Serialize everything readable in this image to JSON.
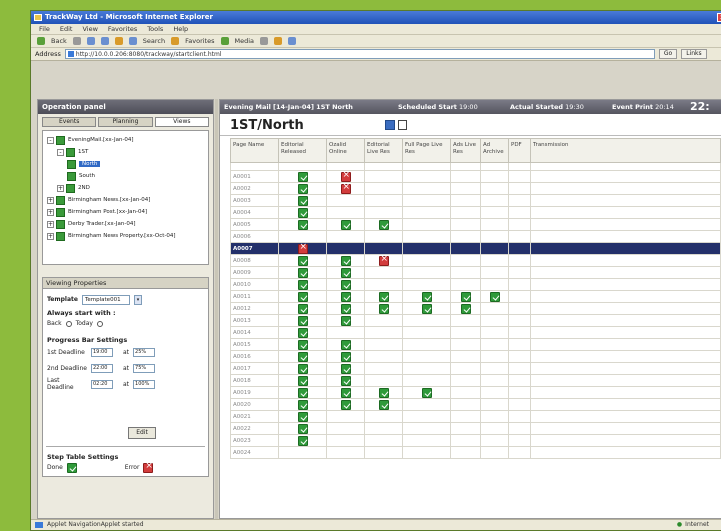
{
  "window": {
    "title": "TrackWay Ltd - Microsoft Internet Explorer"
  },
  "menu": [
    "File",
    "Edit",
    "View",
    "Favorites",
    "Tools",
    "Help"
  ],
  "toolbar": {
    "back": "Back",
    "search": "Search",
    "favorites": "Favorites",
    "media": "Media"
  },
  "address": {
    "label": "Address",
    "url": "http://10.0.0.206:8080/trackway/startclient.html",
    "go": "Go",
    "links": "Links"
  },
  "left": {
    "header": "Operation panel",
    "tabs": [
      "Events",
      "Planning",
      "Views"
    ],
    "tree": [
      {
        "label": "EveningMail.[xx-Jan-04]",
        "level": 0,
        "exp": "-"
      },
      {
        "label": "1ST",
        "level": 1,
        "exp": "-"
      },
      {
        "label": "North",
        "level": 2,
        "exp": "",
        "selected": true
      },
      {
        "label": "South",
        "level": 2,
        "exp": ""
      },
      {
        "label": "2ND",
        "level": 1,
        "exp": "+"
      },
      {
        "label": "Birmingham News.[xx-Jan-04]",
        "level": 0,
        "exp": "+"
      },
      {
        "label": "Birmingham Post.[xx-Jan-04]",
        "level": 0,
        "exp": "+"
      },
      {
        "label": "Derby Trader.[xx-Jan-04]",
        "level": 0,
        "exp": "+"
      },
      {
        "label": "Birmingham News Property.[xx-Oct-04]",
        "level": 0,
        "exp": "+"
      }
    ],
    "props_header": "Viewing Properties",
    "template_label": "Template",
    "template_value": "Template001",
    "always_start": "Always start with :",
    "radio_back": "Back",
    "radio_today": "Today",
    "prog_bar_title": "Progress Bar Settings",
    "deadlines": [
      {
        "label": "1st Deadline",
        "time": "19:00",
        "at": "at",
        "pct": "25%"
      },
      {
        "label": "2nd Deadline",
        "time": "22:00",
        "at": "at",
        "pct": "75%"
      },
      {
        "label": "Last Deadline",
        "time": "02:20",
        "at": "at",
        "pct": "100%"
      }
    ],
    "edit_button": "Edit",
    "step_title": "Step Table Settings",
    "done_label": "Done",
    "error_label": "Error"
  },
  "event": {
    "title": "Evening Mail [14-Jan-04] 1ST North",
    "sched_label": "Scheduled Start",
    "sched_value": "19:00",
    "actual_label": "Actual Started",
    "actual_value": "19:30",
    "event_label": "Event Print",
    "event_value": "20:14",
    "clock": "22:"
  },
  "section_title": "1ST/North",
  "grid": {
    "columns": [
      "Page Name",
      "Editorial Released",
      "Ozalid Online",
      "Editorial Live Res",
      "Full Page Live Res",
      "Ads Live Res",
      "Ad Archive",
      "PDF",
      "Transmission"
    ],
    "rows": [
      {
        "name": "",
        "cells": [
          "",
          "",
          "",
          "",
          "",
          "",
          "",
          ""
        ]
      },
      {
        "name": "A0001",
        "cells": [
          "g",
          "r",
          "",
          "",
          "",
          "",
          "",
          ""
        ]
      },
      {
        "name": "A0002",
        "cells": [
          "g",
          "r",
          "",
          "",
          "",
          "",
          "",
          ""
        ]
      },
      {
        "name": "A0003",
        "cells": [
          "g",
          "",
          "",
          "",
          "",
          "",
          "",
          ""
        ]
      },
      {
        "name": "A0004",
        "cells": [
          "g",
          "",
          "",
          "",
          "",
          "",
          "",
          ""
        ]
      },
      {
        "name": "A0005",
        "cells": [
          "g",
          "g",
          "g",
          "",
          "",
          "",
          "",
          ""
        ]
      },
      {
        "name": "A0006",
        "cells": [
          "",
          "",
          "",
          "",
          "",
          "",
          "",
          ""
        ]
      },
      {
        "name": "A0007",
        "cells": [
          "r",
          "",
          "",
          "",
          "",
          "",
          "",
          ""
        ],
        "selected": true
      },
      {
        "name": "A0008",
        "cells": [
          "g",
          "g",
          "r",
          "",
          "",
          "",
          "",
          ""
        ]
      },
      {
        "name": "A0009",
        "cells": [
          "g",
          "g",
          "",
          "",
          "",
          "",
          "",
          ""
        ]
      },
      {
        "name": "A0010",
        "cells": [
          "g",
          "g",
          "",
          "",
          "",
          "",
          "",
          ""
        ]
      },
      {
        "name": "A0011",
        "cells": [
          "g",
          "g",
          "g",
          "g",
          "g",
          "g",
          "",
          ""
        ]
      },
      {
        "name": "A0012",
        "cells": [
          "g",
          "g",
          "g",
          "g",
          "g",
          "",
          "",
          ""
        ]
      },
      {
        "name": "A0013",
        "cells": [
          "g",
          "g",
          "",
          "",
          "",
          "",
          "",
          ""
        ]
      },
      {
        "name": "A0014",
        "cells": [
          "g",
          "",
          "",
          "",
          "",
          "",
          "",
          ""
        ]
      },
      {
        "name": "A0015",
        "cells": [
          "g",
          "g",
          "",
          "",
          "",
          "",
          "",
          ""
        ]
      },
      {
        "name": "A0016",
        "cells": [
          "g",
          "g",
          "",
          "",
          "",
          "",
          "",
          ""
        ]
      },
      {
        "name": "A0017",
        "cells": [
          "g",
          "g",
          "",
          "",
          "",
          "",
          "",
          ""
        ]
      },
      {
        "name": "A0018",
        "cells": [
          "g",
          "g",
          "",
          "",
          "",
          "",
          "",
          ""
        ]
      },
      {
        "name": "A0019",
        "cells": [
          "g",
          "g",
          "g",
          "g",
          "",
          "",
          "",
          ""
        ]
      },
      {
        "name": "A0020",
        "cells": [
          "g",
          "g",
          "g",
          "",
          "",
          "",
          "",
          ""
        ]
      },
      {
        "name": "A0021",
        "cells": [
          "g",
          "",
          "",
          "",
          "",
          "",
          "",
          ""
        ]
      },
      {
        "name": "A0022",
        "cells": [
          "g",
          "",
          "",
          "",
          "",
          "",
          "",
          ""
        ]
      },
      {
        "name": "A0023",
        "cells": [
          "g",
          "",
          "",
          "",
          "",
          "",
          "",
          ""
        ]
      },
      {
        "name": "A0024",
        "cells": [
          "",
          "",
          "",
          "",
          "",
          "",
          "",
          ""
        ]
      }
    ]
  },
  "status": {
    "text": "Applet NavigationApplet started",
    "zone": "Internet"
  },
  "colors": {
    "background": "#8dbb3d",
    "done": "#2f9a3a",
    "error": "#d23c3c",
    "selected_row": "#23306a"
  }
}
